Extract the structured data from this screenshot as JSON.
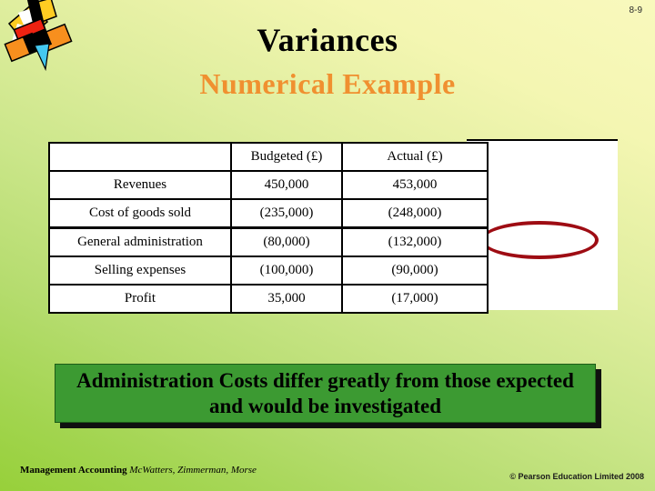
{
  "slide": {
    "number": "8-9",
    "title": "Variances",
    "subtitle": "Numerical Example",
    "background_top_right": "#f9f9bd",
    "background_bottom_left": "#97d03a"
  },
  "logo": {
    "name": "decorative-abstract-logo",
    "colors": {
      "yellow": "#ffcc22",
      "red": "#ee2211",
      "orange": "#f78f1e",
      "black": "#000000",
      "cyan": "#44c8f0"
    }
  },
  "table": {
    "header": [
      "",
      "Budgeted (£)",
      "Actual (£)"
    ],
    "rows_top": [
      [
        "Revenues",
        "450,000",
        "453,000"
      ],
      [
        "Cost of goods sold",
        "(235,000)",
        "(248,000)"
      ]
    ],
    "rows_bottom": [
      [
        "General administration",
        "(80,000)",
        "(132,000)"
      ],
      [
        "Selling expenses",
        "(100,000)",
        "(90,000)"
      ],
      [
        "Profit",
        "35,000",
        "(17,000)"
      ]
    ]
  },
  "annotation": {
    "name": "red-ellipse-highlight",
    "color": "#9e0c13"
  },
  "callout": {
    "text": "Administration Costs differ greatly from those expected and would be investigated",
    "background": "#3c9a32",
    "text_color": "#000000"
  },
  "footer": {
    "book_title": "Management Accounting",
    "authors": "McWatters, Zimmerman, Morse",
    "copyright": "© Pearson Education Limited 2008"
  }
}
